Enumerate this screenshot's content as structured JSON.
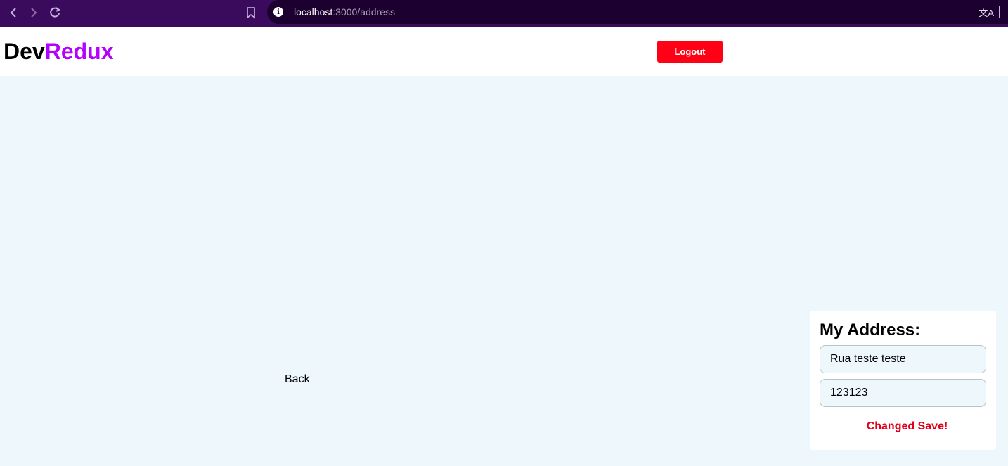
{
  "browser": {
    "url_host": "localhost",
    "url_path": ":3000/address",
    "icons": {
      "back": "chevron-left-icon",
      "forward": "chevron-right-icon",
      "reload": "reload-icon",
      "bookmark": "bookmark-icon",
      "info": "info-icon",
      "translate": "translate-icon"
    }
  },
  "header": {
    "logo_part1": "Dev",
    "logo_part2": "Redux",
    "logout_label": "Logout"
  },
  "main": {
    "back_label": "Back",
    "address_card": {
      "title": "My Address:",
      "street_value": "Rua teste teste",
      "number_value": "123123",
      "status": "Changed Save!"
    }
  },
  "colors": {
    "chrome_bg": "#3a0a5c",
    "omnibox_bg": "#1c0030",
    "page_bg": "#eef8fc",
    "brand_accent": "#b400ff",
    "logout_bg": "#ff0015",
    "status_text": "#e0001a"
  }
}
